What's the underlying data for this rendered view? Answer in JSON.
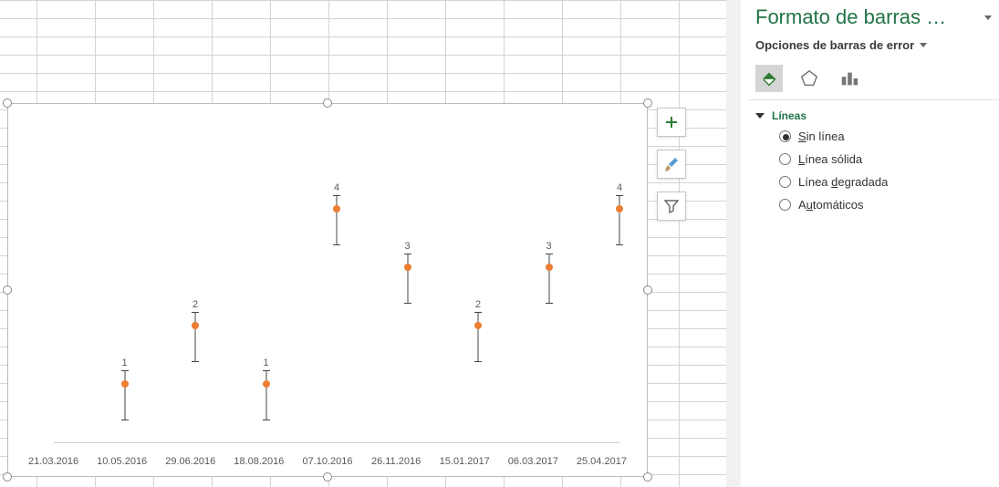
{
  "pane": {
    "title": "Formato de barras …",
    "subtitle": "Opciones de barras de error",
    "section_label": "Líneas",
    "options": {
      "none": "Sin línea",
      "solid": "Línea sólida",
      "gradient": "Línea degradada",
      "auto": "Automáticos"
    },
    "selected": "none",
    "tabs": [
      "fill-icon",
      "effects-icon",
      "bar-options-icon"
    ],
    "active_tab": 0
  },
  "chart_data": {
    "type": "scatter",
    "x_ticks": [
      "21.03.2016",
      "10.05.2016",
      "29.06.2016",
      "18.08.2016",
      "07.10.2016",
      "26.11.2016",
      "15.01.2017",
      "06.03.2017",
      "25.04.2017"
    ],
    "ylim": [
      0,
      5
    ],
    "error_bar": {
      "minus": 0.6,
      "plus": 0.25
    },
    "points": [
      {
        "xi": 1,
        "y": 1,
        "label": "1"
      },
      {
        "xi": 2,
        "y": 2,
        "label": "2"
      },
      {
        "xi": 3,
        "y": 1,
        "label": "1"
      },
      {
        "xi": 4,
        "y": 4,
        "label": "4"
      },
      {
        "xi": 5,
        "y": 3,
        "label": "3"
      },
      {
        "xi": 6,
        "y": 2,
        "label": "2"
      },
      {
        "xi": 7,
        "y": 3,
        "label": "3"
      },
      {
        "xi": 8,
        "y": 4,
        "label": "4"
      }
    ]
  },
  "chart_buttons": {
    "add": "Add Chart Element",
    "style": "Chart Styles",
    "filter": "Chart Filters"
  }
}
